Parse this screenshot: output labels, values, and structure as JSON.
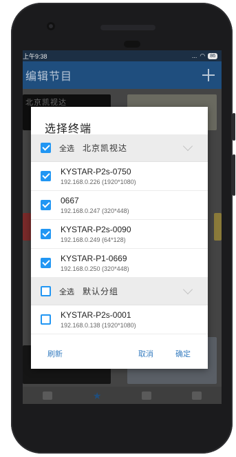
{
  "status_bar": {
    "time": "上午9:38",
    "signal_text": "... ",
    "battery": "86"
  },
  "app_bar": {
    "title": "编辑节目"
  },
  "background": {
    "tile_text": "北京凯视达"
  },
  "dialog": {
    "title": "选择终端",
    "groups": [
      {
        "select_all_label": "全选",
        "name": "北京凯视达",
        "checked": true,
        "items": [
          {
            "name": "KYSTAR-P2s-0750",
            "sub": "192.168.0.226 (1920*1080)",
            "checked": true
          },
          {
            "name": "0667",
            "sub": "192.168.0.247 (320*448)",
            "checked": true
          },
          {
            "name": "KYSTAR-P2s-0090",
            "sub": "192.168.0.249 (64*128)",
            "checked": true
          },
          {
            "name": "KYSTAR-P1-0669",
            "sub": "192.168.0.250 (320*448)",
            "checked": true
          }
        ]
      },
      {
        "select_all_label": "全选",
        "name": "默认分组",
        "checked": false,
        "items": [
          {
            "name": "KYSTAR-P2s-0001",
            "sub": "192.168.0.138 (1920*1080)",
            "checked": false
          }
        ]
      }
    ],
    "actions": {
      "refresh": "刷新",
      "cancel": "取消",
      "confirm": "确定"
    }
  },
  "colors": {
    "accent": "#2196f3",
    "appbar": "#1f4e7e",
    "action_text": "#3a7fc1"
  },
  "icons": {
    "add": "plus-icon",
    "checkbox_on": "checkbox-checked-icon",
    "checkbox_off": "checkbox-unchecked-icon",
    "expand": "chevron-down-icon"
  }
}
